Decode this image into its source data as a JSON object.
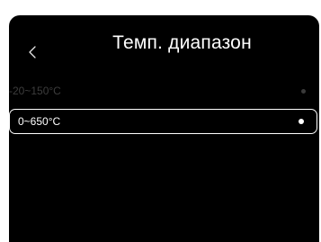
{
  "header": {
    "title": "Темп. диапазон",
    "back_icon": "chevron-left-icon"
  },
  "options": [
    {
      "label": "-20~150°C",
      "state": "disabled"
    },
    {
      "label": "0~650°C",
      "state": "selected"
    }
  ],
  "colors": {
    "background": "#000000",
    "text": "#ffffff",
    "disabled_text": "#3d3d3d",
    "selection_border": "#ffffff"
  }
}
